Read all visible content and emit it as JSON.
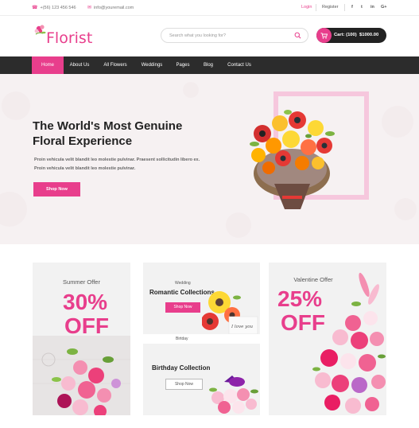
{
  "topbar": {
    "phone": "+(56) 123 456 546",
    "email": "info@youremail.com",
    "login": "Login",
    "register": "Register",
    "social": [
      "f",
      "t",
      "in",
      "G+"
    ]
  },
  "header": {
    "logo_text": "Florist",
    "search_placeholder": "Search what you looking for?",
    "cart_label": "Cart: (100)",
    "cart_total": "$1000.00"
  },
  "nav": {
    "items": [
      "Home",
      "About Us",
      "All Flowers",
      "Weddings",
      "Pages",
      "Blog",
      "Contact Us"
    ],
    "active": "Home"
  },
  "hero": {
    "title_line1": "The World's Most Genuine",
    "title_line2": "Floral Experience",
    "text": "Proin vehicula velit blandit leo molestie pulvinar. Praesent sollicitudin libero ex. Proin vehicula velit blandit leo molestie pulvinar.",
    "button": "Shop Now"
  },
  "promos": {
    "summer": {
      "label": "Summer Offer",
      "pct": "30%",
      "off": "OFF"
    },
    "wedding": {
      "sub": "Wedding",
      "title": "Romantic Collections",
      "button": "Shop Now",
      "card_text": "I love you"
    },
    "birthday": {
      "sub": "Birtday",
      "title": "Birthday Collection",
      "button": "Shop Now"
    },
    "valentine": {
      "label": "Valentine Offer",
      "pct": "25%",
      "off": "OFF"
    }
  },
  "colors": {
    "accent": "#e83e8c",
    "dark": "#2c2c2c",
    "hero_bg": "#f6f1f2",
    "card_bg": "#f2f2f2"
  }
}
